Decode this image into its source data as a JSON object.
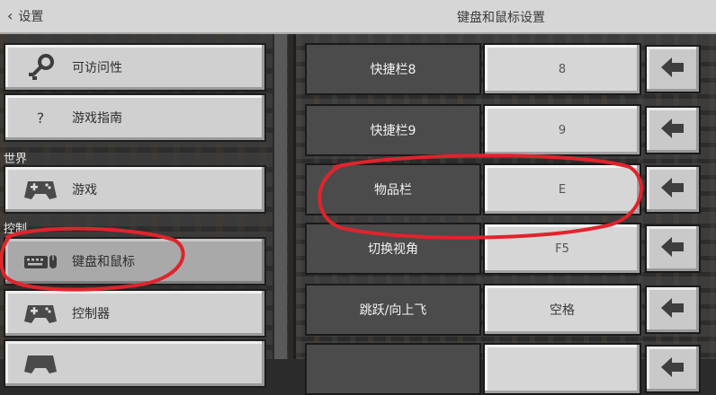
{
  "header": {
    "back_label": "设置",
    "title": "键盘和鼠标设置"
  },
  "sidebar": {
    "items": [
      {
        "label": "可访问性",
        "icon": "key-icon"
      },
      {
        "label": "游戏指南",
        "icon": "question-icon",
        "glyph": "?"
      },
      {
        "label": "游戏",
        "icon": "gamepad-icon"
      },
      {
        "label": "键盘和鼠标",
        "icon": "keyboard-mouse-icon"
      },
      {
        "label": "控制器",
        "icon": "gamepad-icon"
      },
      {
        "label": "",
        "icon": "controller-icon"
      }
    ],
    "sections": {
      "world": "世界",
      "controls": "控制"
    },
    "selected": "键盘和鼠标"
  },
  "bindings": [
    {
      "action": "快捷栏8",
      "key": "8"
    },
    {
      "action": "快捷栏9",
      "key": "9"
    },
    {
      "action": "物品栏",
      "key": "E"
    },
    {
      "action": "切换视角",
      "key": "F5"
    },
    {
      "action": "跳跃/向上飞",
      "key": "空格"
    },
    {
      "action": "",
      "key": ""
    }
  ],
  "colors": {
    "annotation": "#e0242c",
    "tile": "#d0d0d0",
    "action_bg": "#4b4b4b"
  }
}
